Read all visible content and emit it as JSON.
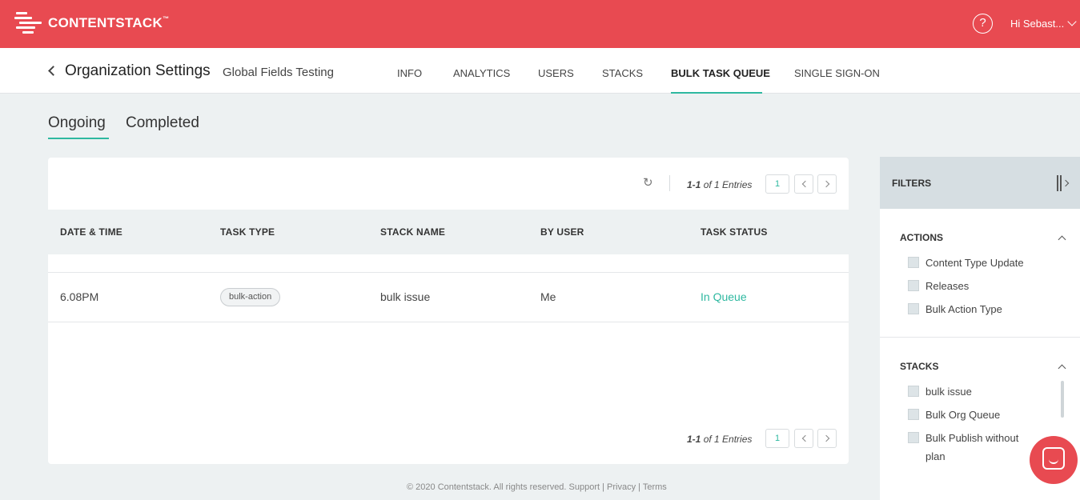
{
  "brand": {
    "name": "CONTENTSTACK",
    "tm": "™",
    "primary_color": "#e84a51",
    "accent_color": "#2eb8a0"
  },
  "topbar": {
    "help_icon": "?",
    "user_greeting": "Hi Sebast..."
  },
  "subheader": {
    "title": "Organization Settings",
    "org_name": "Global Fields Testing",
    "nav": [
      "INFO",
      "ANALYTICS",
      "USERS",
      "STACKS",
      "BULK TASK QUEUE",
      "SINGLE SIGN-ON"
    ],
    "active_nav": "BULK TASK QUEUE"
  },
  "tabs": [
    "Ongoing",
    "Completed"
  ],
  "active_tab": "Ongoing",
  "pagination": {
    "range": "1-1",
    "text": "of 1 Entries",
    "page": "1"
  },
  "table": {
    "columns": [
      "DATE & TIME",
      "TASK TYPE",
      "STACK NAME",
      "BY USER",
      "TASK STATUS"
    ],
    "rows": [
      {
        "time": "6.08PM",
        "task_type": "bulk-action",
        "stack": "bulk issue",
        "user": "Me",
        "status": "In Queue"
      }
    ]
  },
  "filters": {
    "title": "FILTERS",
    "actions": {
      "title": "ACTIONS",
      "items": [
        "Content Type Update",
        "Releases",
        "Bulk Action Type"
      ]
    },
    "stacks": {
      "title": "STACKS",
      "items": [
        "bulk issue",
        "Bulk Org Queue",
        "Bulk Publish without",
        "plan"
      ]
    }
  },
  "footer": "© 2020 Contentstack. All rights reserved. Support | Privacy | Terms"
}
